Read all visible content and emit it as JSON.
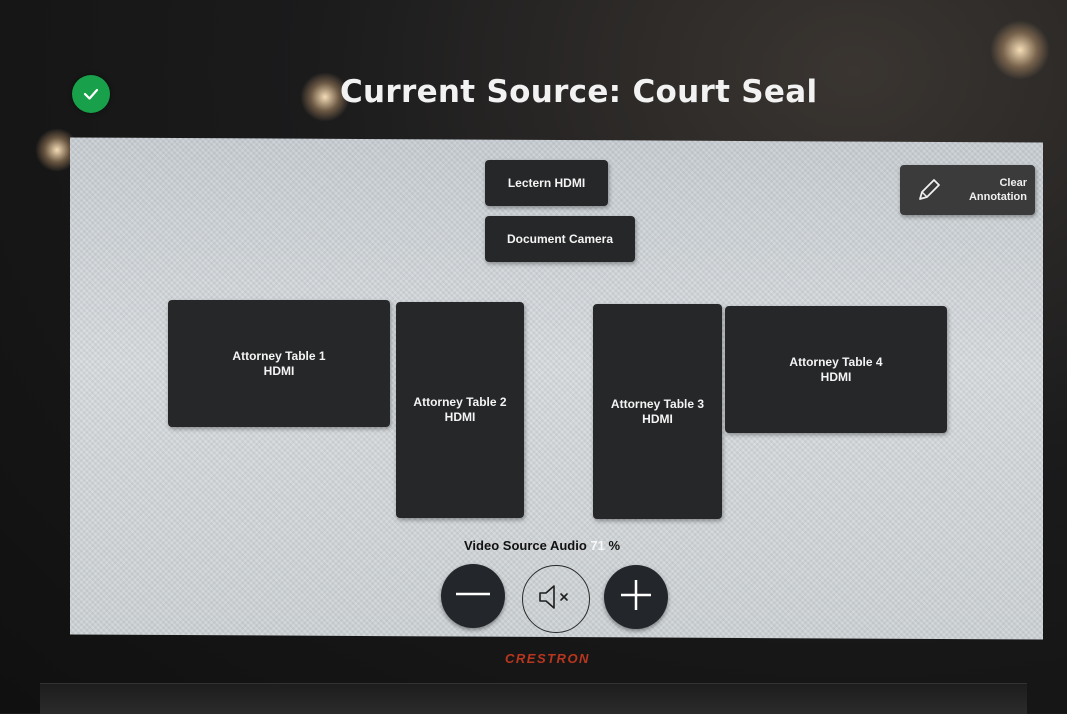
{
  "header": {
    "title": "Current Source: Court Seal",
    "status_icon": "check-icon",
    "status_color": "#19a04a"
  },
  "sources": {
    "lectern": "Lectern HDMI",
    "doc_camera": "Document Camera",
    "attorney_tables": [
      {
        "label": "Attorney Table 1\nHDMI"
      },
      {
        "label": "Attorney Table 2\nHDMI"
      },
      {
        "label": "Attorney Table 3\nHDMI"
      },
      {
        "label": "Attorney Table 4\nHDMI"
      }
    ]
  },
  "annotation": {
    "clear_label": "Clear\nAnnotation",
    "icon": "pencil-icon"
  },
  "audio": {
    "label": "Video Source Audio",
    "value": "71",
    "unit": "%",
    "decrease_icon": "minus-icon",
    "mute_icon": "speaker-mute-icon",
    "increase_icon": "plus-icon"
  },
  "brand": "CRESTRON",
  "colors": {
    "button_bg": "#262729",
    "accent_brand": "#b8361e"
  }
}
